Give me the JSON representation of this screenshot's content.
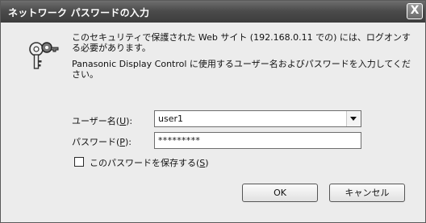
{
  "dialog": {
    "title": "ネットワーク パスワードの入力",
    "close_label": "X"
  },
  "message": {
    "line1": "このセキュリティで保護された Web サイト (192.168.0.11 での) には、ログオンする必要があります。",
    "line2": "Panasonic Display Control に使用するユーザー名およびパスワードを入力してください。"
  },
  "form": {
    "username_label": "ユーザー名",
    "username_accel": "U",
    "username_value": "user1",
    "password_label": "パスワード",
    "password_accel": "P",
    "password_value": "*********",
    "save_label": "このパスワードを保存する",
    "save_accel": "S",
    "save_checked": false
  },
  "buttons": {
    "ok": "OK",
    "cancel": "キャンセル"
  },
  "icons": {
    "dialog_icon": "key-icon",
    "close": "close-icon",
    "dropdown": "chevron-down-icon"
  }
}
